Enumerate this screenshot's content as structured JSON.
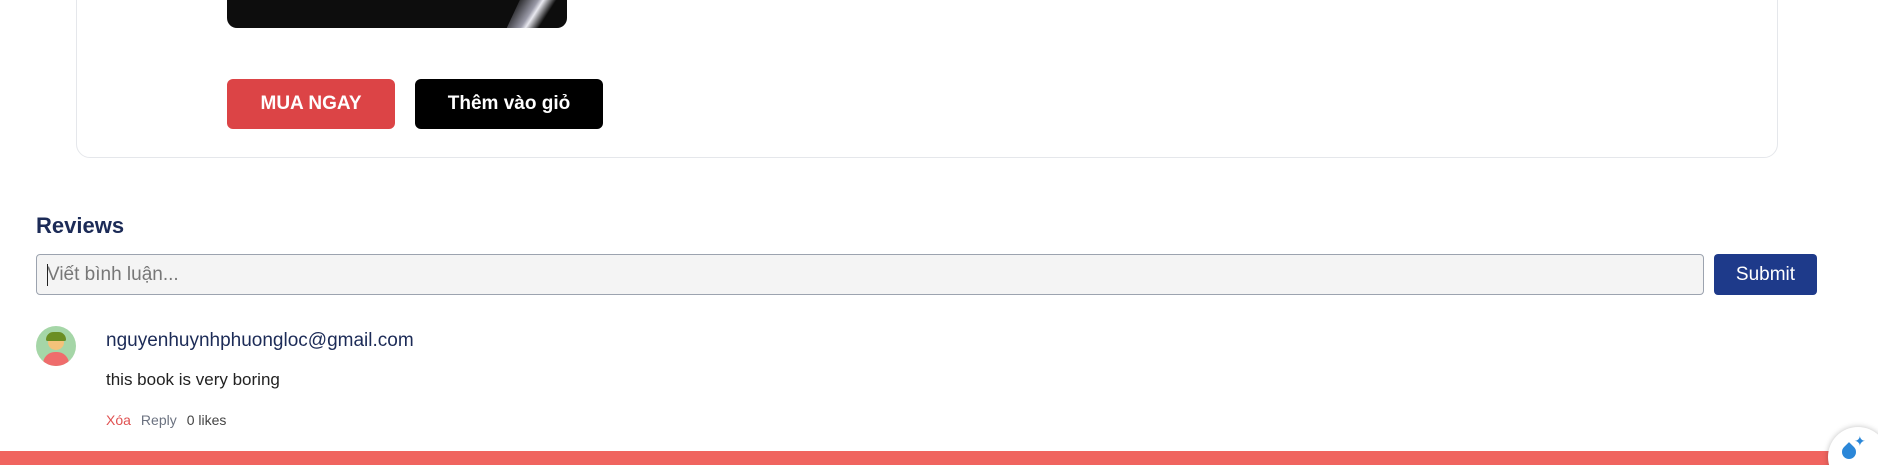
{
  "product": {
    "buy_now_label": "MUA NGAY",
    "add_to_cart_label": "Thêm vào giỏ"
  },
  "reviews": {
    "title": "Reviews",
    "input_placeholder": "Viết bình luận...",
    "input_value": "",
    "submit_label": "Submit",
    "comments": [
      {
        "author": "nguyenhuynhphuongloc@gmail.com",
        "text": "this book is very boring",
        "delete_label": "Xóa",
        "reply_label": "Reply",
        "likes_label": "0 likes"
      }
    ]
  },
  "icons": {
    "avatar": "user-avatar",
    "floating": "assistant-sparkle-icon"
  },
  "colors": {
    "buy_button": "#dc4446",
    "cart_button": "#000000",
    "submit_button": "#1e3a8a",
    "heading": "#1c2b57",
    "delete_link": "#e05252",
    "footer": "#f0645f"
  }
}
